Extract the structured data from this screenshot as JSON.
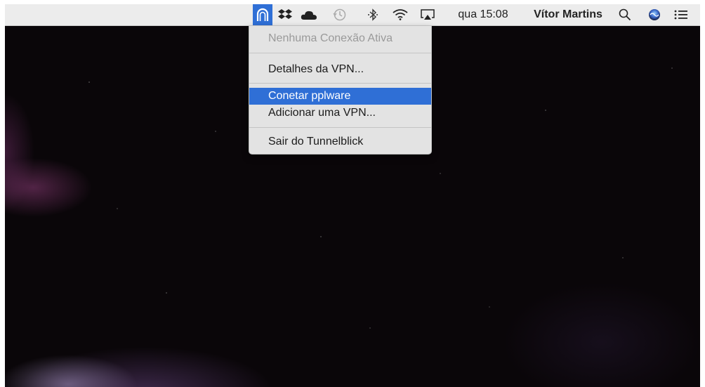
{
  "menubar": {
    "clock": "qua 15:08",
    "user": "Vítor Martins",
    "icons": [
      "tunnelblick-icon",
      "dropbox-icon",
      "cloud-icon",
      "time-machine-icon",
      "bluetooth-icon",
      "wifi-icon",
      "airplay-icon",
      "search-icon",
      "siri-icon",
      "notification-center-icon"
    ],
    "accent_color": "#2f6fd6"
  },
  "menu": {
    "status": "Nenhuma Conexão Ativa",
    "vpn_details": "Detalhes da VPN...",
    "connect": "Conetar pplware",
    "add_vpn": "Adicionar uma VPN...",
    "quit": "Sair do Tunnelblick"
  }
}
